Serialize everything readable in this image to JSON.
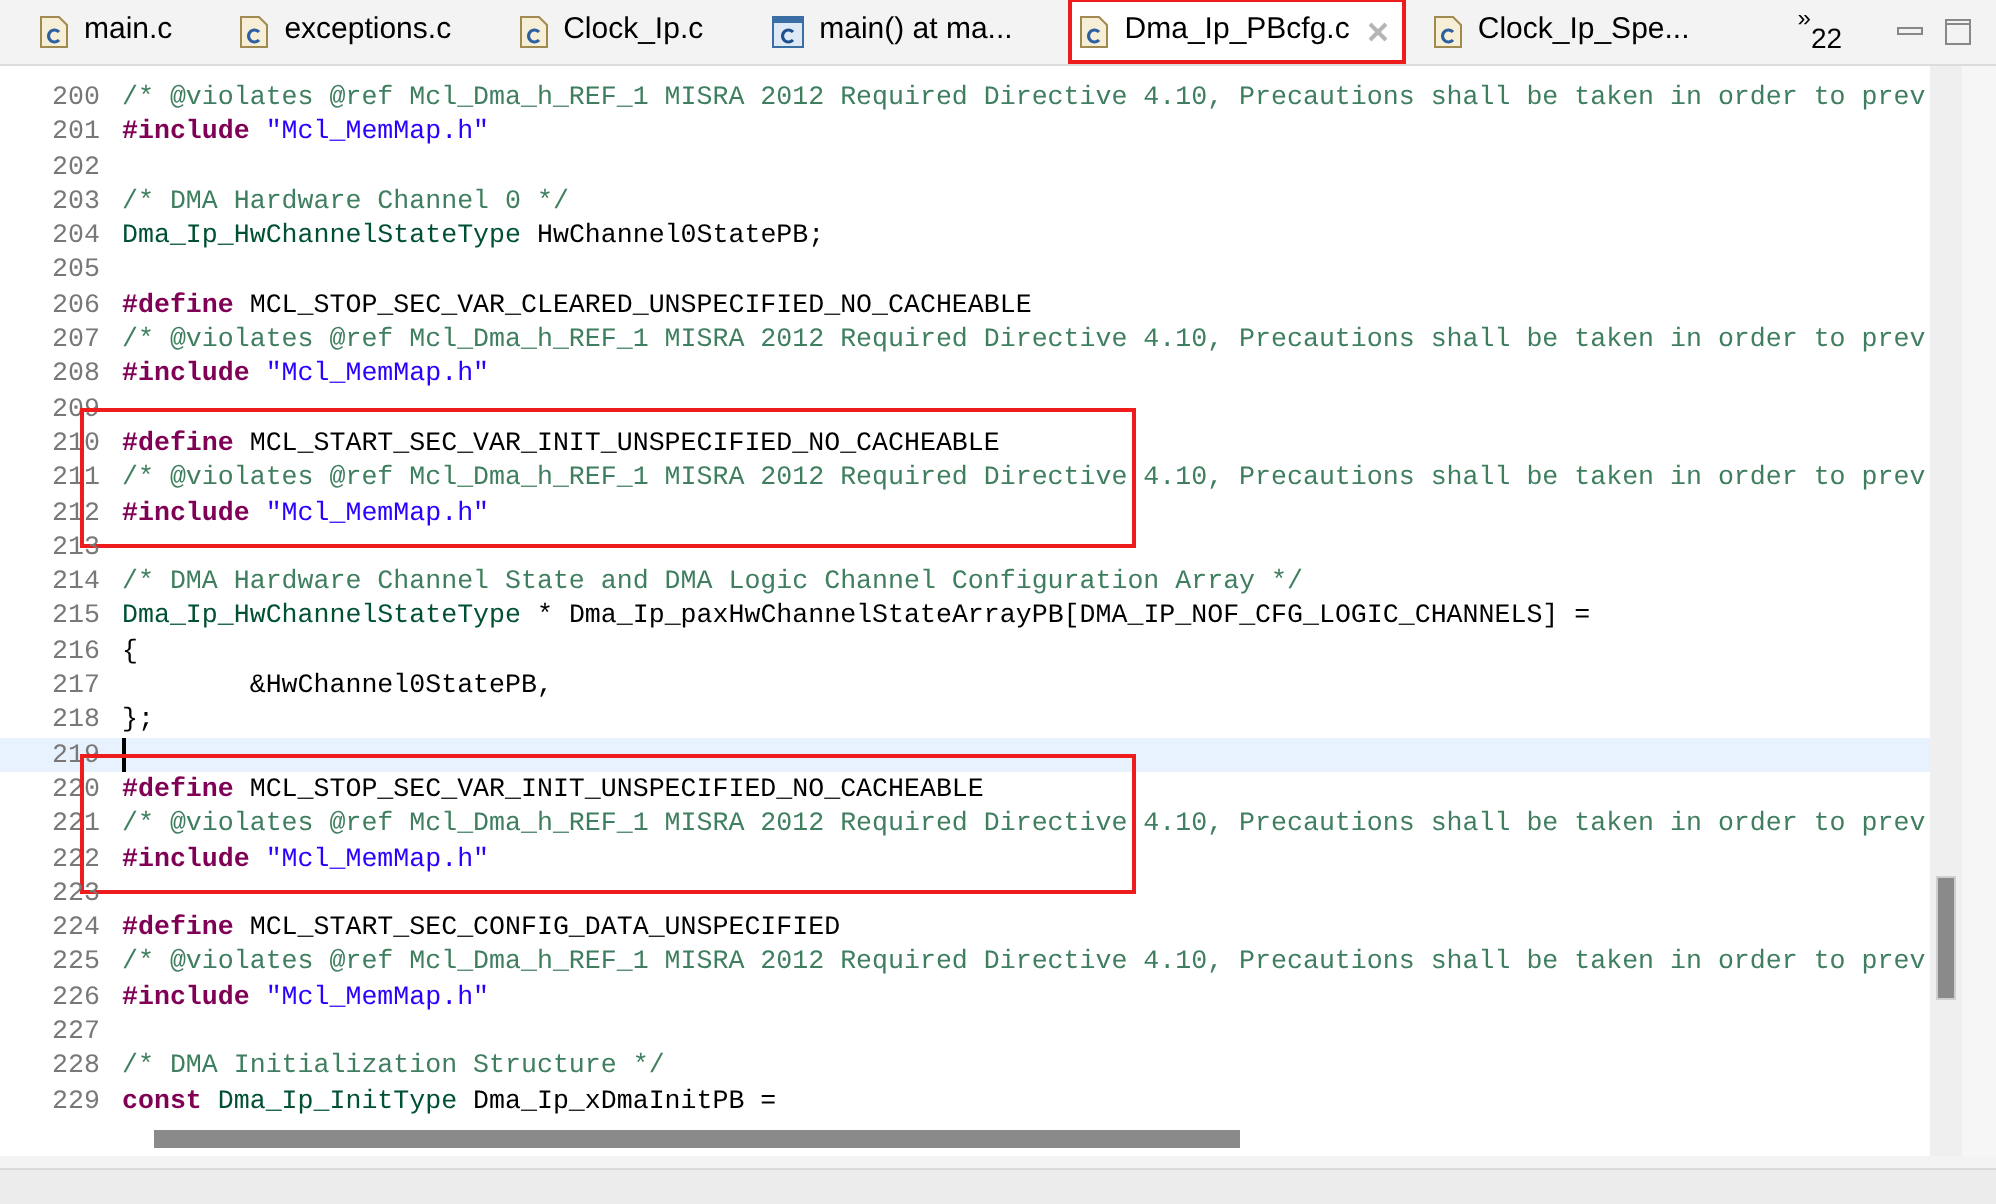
{
  "tabs": [
    {
      "label": "main.c",
      "selected": false,
      "boxed": false,
      "kind": "source"
    },
    {
      "label": "exceptions.c",
      "selected": false,
      "boxed": false,
      "kind": "source"
    },
    {
      "label": "Clock_Ip.c",
      "selected": false,
      "boxed": false,
      "kind": "source"
    },
    {
      "label": "main() at ma...",
      "selected": false,
      "boxed": false,
      "kind": "debug"
    },
    {
      "label": "Dma_Ip_PBcfg.c",
      "selected": true,
      "boxed": true,
      "kind": "source"
    },
    {
      "label": "Clock_Ip_Spe...",
      "selected": false,
      "boxed": false,
      "kind": "source"
    }
  ],
  "overflow_tabs": {
    "marker": "»",
    "count": "22"
  },
  "editor": {
    "blocks": [
      {
        "boxed": false,
        "lines": [
          {
            "number": "200",
            "current": false,
            "tokens": [
              {
                "kind": "comment",
                "text": "/* @violates @ref Mcl_Dma_h_REF_1 MISRA 2012 Required Directive 4.10, Precautions shall be taken in order to prev"
              }
            ]
          },
          {
            "number": "201",
            "current": false,
            "tokens": [
              {
                "kind": "keyword",
                "text": "#include"
              },
              {
                "kind": "string",
                "text": " \"Mcl_MemMap.h\""
              }
            ]
          },
          {
            "number": "202",
            "current": false
          },
          {
            "number": "203",
            "current": false,
            "tokens": [
              {
                "kind": "comment",
                "text": "/* DMA Hardware Channel 0 */"
              }
            ]
          },
          {
            "number": "204",
            "current": false,
            "tokens": [
              {
                "kind": "type",
                "text": "Dma_Ip_HwChannelStateType"
              },
              {
                "kind": "plain",
                "text": " HwChannel0StatePB;"
              }
            ]
          },
          {
            "number": "205",
            "current": false
          },
          {
            "number": "206",
            "current": false,
            "tokens": [
              {
                "kind": "keyword",
                "text": "#define"
              },
              {
                "kind": "plain",
                "text": " MCL_STOP_SEC_VAR_CLEARED_UNSPECIFIED_NO_CACHEABLE"
              }
            ]
          },
          {
            "number": "207",
            "current": false,
            "tokens": [
              {
                "kind": "comment",
                "text": "/* @violates @ref Mcl_Dma_h_REF_1 MISRA 2012 Required Directive 4.10, Precautions shall be taken in order to prev"
              }
            ]
          },
          {
            "number": "208",
            "current": false,
            "tokens": [
              {
                "kind": "keyword",
                "text": "#include"
              },
              {
                "kind": "string",
                "text": " \"Mcl_MemMap.h\""
              }
            ]
          },
          {
            "number": "209",
            "current": false
          }
        ]
      },
      {
        "boxed": true,
        "lines": [
          {
            "number": "210",
            "current": false,
            "tokens": [
              {
                "kind": "keyword",
                "text": "#define"
              },
              {
                "kind": "plain",
                "text": " MCL_START_SEC_VAR_INIT_UNSPECIFIED_NO_CACHEABLE"
              }
            ]
          },
          {
            "number": "211",
            "current": false,
            "tokens": [
              {
                "kind": "comment",
                "text": "/* @violates @ref Mcl_Dma_h_REF_1 MISRA 2012 Required Directive 4.10, Precautions shall be taken in order to prev"
              }
            ]
          },
          {
            "number": "212",
            "current": false,
            "tokens": [
              {
                "kind": "keyword",
                "text": "#include"
              },
              {
                "kind": "string",
                "text": " \"Mcl_MemMap.h\""
              }
            ]
          }
        ]
      },
      {
        "boxed": false,
        "lines": [
          {
            "number": "213",
            "current": false
          },
          {
            "number": "214",
            "current": false,
            "tokens": [
              {
                "kind": "comment",
                "text": "/* DMA Hardware Channel State and DMA Logic Channel Configuration Array */"
              }
            ]
          },
          {
            "number": "215",
            "current": false,
            "tokens": [
              {
                "kind": "type",
                "text": "Dma_Ip_HwChannelStateType"
              },
              {
                "kind": "plain",
                "text": " * Dma_Ip_paxHwChannelStateArrayPB[DMA_IP_NOF_CFG_LOGIC_CHANNELS] ="
              }
            ]
          },
          {
            "number": "216",
            "current": false,
            "tokens": [
              {
                "kind": "plain",
                "text": "{"
              }
            ]
          },
          {
            "number": "217",
            "current": false,
            "tokens": [
              {
                "kind": "plain",
                "text": "        &HwChannel0StatePB,"
              }
            ]
          },
          {
            "number": "218",
            "current": false,
            "tokens": [
              {
                "kind": "plain",
                "text": "};"
              }
            ]
          },
          {
            "number": "219",
            "current": true
          }
        ]
      },
      {
        "boxed": true,
        "lines": [
          {
            "number": "220",
            "current": false,
            "tokens": [
              {
                "kind": "keyword",
                "text": "#define"
              },
              {
                "kind": "plain",
                "text": " MCL_STOP_SEC_VAR_INIT_UNSPECIFIED_NO_CACHEABLE"
              }
            ]
          },
          {
            "number": "221",
            "current": false,
            "tokens": [
              {
                "kind": "comment",
                "text": "/* @violates @ref Mcl_Dma_h_REF_1 MISRA 2012 Required Directive 4.10, Precautions shall be taken in order to prev"
              }
            ]
          },
          {
            "number": "222",
            "current": false,
            "tokens": [
              {
                "kind": "keyword",
                "text": "#include"
              },
              {
                "kind": "string",
                "text": " \"Mcl_MemMap.h\""
              }
            ]
          }
        ]
      },
      {
        "boxed": false,
        "lines": [
          {
            "number": "223",
            "current": false
          },
          {
            "number": "224",
            "current": false,
            "tokens": [
              {
                "kind": "keyword",
                "text": "#define"
              },
              {
                "kind": "plain",
                "text": " MCL_START_SEC_CONFIG_DATA_UNSPECIFIED"
              }
            ]
          },
          {
            "number": "225",
            "current": false,
            "tokens": [
              {
                "kind": "comment",
                "text": "/* @violates @ref Mcl_Dma_h_REF_1 MISRA 2012 Required Directive 4.10, Precautions shall be taken in order to prev"
              }
            ]
          },
          {
            "number": "226",
            "current": false,
            "tokens": [
              {
                "kind": "keyword",
                "text": "#include"
              },
              {
                "kind": "string",
                "text": " \"Mcl_MemMap.h\""
              }
            ]
          },
          {
            "number": "227",
            "current": false
          },
          {
            "number": "228",
            "current": false,
            "tokens": [
              {
                "kind": "comment",
                "text": "/* DMA Initialization Structure */"
              }
            ]
          },
          {
            "number": "229",
            "current": false,
            "tokens": [
              {
                "kind": "keyword",
                "text": "const"
              },
              {
                "kind": "type",
                "text": " Dma_Ip_InitType"
              },
              {
                "kind": "plain",
                "text": " Dma_Ip_xDmaInitPB ="
              }
            ]
          }
        ]
      }
    ]
  }
}
